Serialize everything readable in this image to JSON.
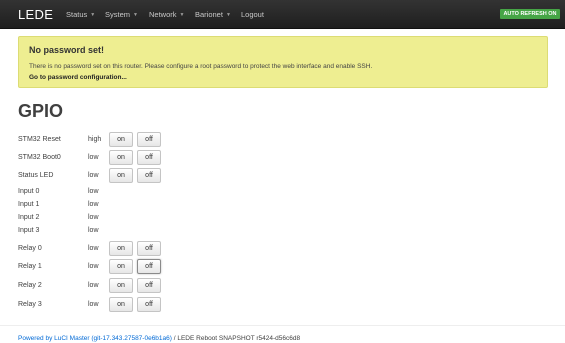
{
  "brand": "LEDE",
  "nav": {
    "items": [
      {
        "label": "Status",
        "caret": "▼"
      },
      {
        "label": "System",
        "caret": "▼"
      },
      {
        "label": "Network",
        "caret": "▼"
      },
      {
        "label": "Barionet",
        "caret": "▼"
      },
      {
        "label": "Logout",
        "caret": ""
      }
    ],
    "refresh_badge": "AUTO REFRESH ON"
  },
  "alert": {
    "title": "No password set!",
    "text": "There is no password set on this router. Please configure a root password to protect the web interface and enable SSH.",
    "link": "Go to password configuration..."
  },
  "page_title": "GPIO",
  "gpio": [
    {
      "label": "STM32 Reset",
      "value": "high",
      "on": "on",
      "off": "off",
      "active": ""
    },
    {
      "label": "STM32 Boot0",
      "value": "low",
      "on": "on",
      "off": "off",
      "active": ""
    },
    {
      "label": "Status LED",
      "value": "low",
      "on": "on",
      "off": "off",
      "active": ""
    },
    {
      "label": "Input 0",
      "value": "low"
    },
    {
      "label": "Input 1",
      "value": "low"
    },
    {
      "label": "Input 2",
      "value": "low"
    },
    {
      "label": "Input 3",
      "value": "low"
    },
    {
      "label": "Relay 0",
      "value": "low",
      "on": "on",
      "off": "off",
      "active": ""
    },
    {
      "label": "Relay 1",
      "value": "low",
      "on": "on",
      "off": "off",
      "active": "off"
    },
    {
      "label": "Relay 2",
      "value": "low",
      "on": "on",
      "off": "off",
      "active": ""
    },
    {
      "label": "Relay 3",
      "value": "low",
      "on": "on",
      "off": "off",
      "active": ""
    }
  ],
  "footer": {
    "link": "Powered by LuCI Master (git-17.343.27587-0e6b1a6)",
    "text": " / LEDE Reboot SNAPSHOT r5424-d56c6d8"
  },
  "colors": {
    "navbar": "#222222",
    "alert_bg": "#eeee91",
    "refresh_badge": "#46a546",
    "link": "#0069d6"
  }
}
